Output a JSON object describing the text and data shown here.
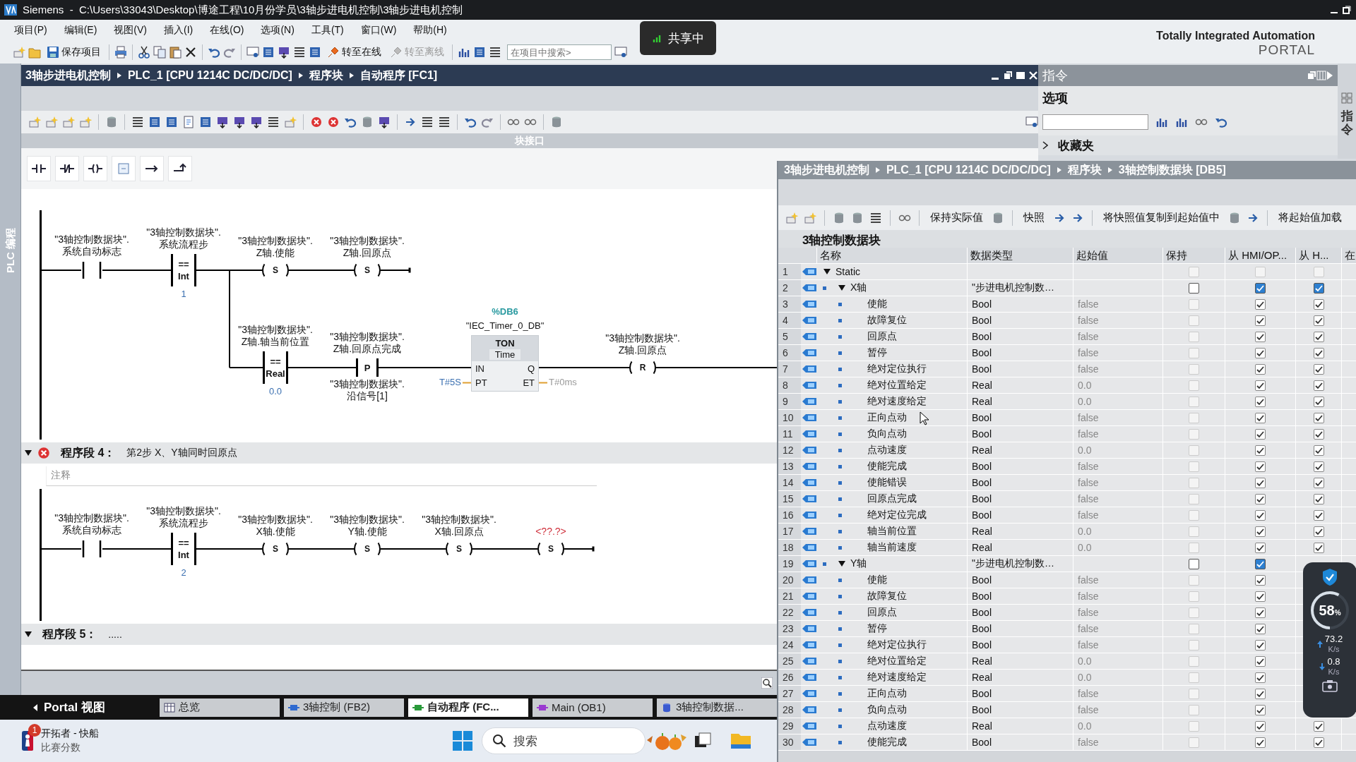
{
  "window": {
    "title": "Siemens  -  C:\\Users\\33043\\Desktop\\博途工程\\10月份学员\\3轴步进电机控制\\3轴步进电机控制"
  },
  "menu": [
    "项目(P)",
    "编辑(E)",
    "视图(V)",
    "插入(I)",
    "在线(O)",
    "选项(N)",
    "工具(T)",
    "窗口(W)",
    "帮助(H)"
  ],
  "toolbar": {
    "buttons": [
      {
        "label": "保存项目",
        "disabled": false
      },
      {
        "label": "转至在线",
        "disabled": false
      },
      {
        "label": "转至离线",
        "disabled": true
      }
    ],
    "search": {
      "placeholder": "在项目中搜索>"
    }
  },
  "brand": {
    "line1": "Totally Integrated Automation",
    "line2": "PORTAL"
  },
  "sharing_badge": {
    "label": "共享中"
  },
  "side_tab": {
    "label": "PLC 编程"
  },
  "editor": {
    "breadcrumb": [
      "3轴步进电机控制",
      "PLC_1 [CPU 1214C DC/DC/DC]",
      "程序块",
      "自动程序 [FC1]"
    ],
    "interface_bar": "块接口",
    "networks": [
      {
        "rows": [
          {
            "elements": [
              {
                "kind": "contact",
                "operand": "\"3轴控制数据块\".\n系统自动标志"
              },
              {
                "kind": "compare",
                "operand": "\"3轴控制数据块\".\n系统流程步",
                "op": "==",
                "type": "Int",
                "value": "1"
              },
              {
                "kind": "branch",
                "rows": [
                  {
                    "continues": false,
                    "elements": [
                      {
                        "kind": "coil",
                        "operand": "\"3轴控制数据块\".\nZ轴.使能",
                        "letter": "S",
                        "missing": false
                      },
                      {
                        "kind": "coil",
                        "operand": "\"3轴控制数据块\".\nZ轴.回原点",
                        "letter": "S",
                        "missing": false
                      }
                    ]
                  },
                  {
                    "continues": true,
                    "elements": [
                      {
                        "kind": "compare",
                        "operand": "\"3轴控制数据块\".\nZ轴.轴当前位置",
                        "op": "==",
                        "type": "Real",
                        "value": "0.0"
                      },
                      {
                        "kind": "edge",
                        "operand": "\"3轴控制数据块\".\nZ轴.回原点完成",
                        "letter": "P",
                        "operand_below": "\"3轴控制数据块\".\n沿信号[1]"
                      },
                      {
                        "kind": "timer",
                        "instance": "%DB6",
                        "instance_name": "\"IEC_Timer_0_DB\"",
                        "type": "TON",
                        "time_type": "Time",
                        "pins": [
                          {
                            "left": "IN",
                            "right": "Q"
                          },
                          {
                            "left": "PT",
                            "right": "ET",
                            "left_value": "T#5S",
                            "right_value": "T#0ms"
                          }
                        ]
                      },
                      {
                        "kind": "coil",
                        "operand": "\"3轴控制数据块\".\nZ轴.回原点",
                        "letter": "R",
                        "missing": false
                      }
                    ]
                  }
                ]
              }
            ]
          }
        ]
      },
      {
        "header": {
          "expanded": true,
          "error": true,
          "title": "程序段 4：",
          "comment": "第2步 X、Y轴同时回原点"
        },
        "comment_placeholder": "注释",
        "rows": [
          {
            "elements": [
              {
                "kind": "contact",
                "operand": "\"3轴控制数据块\".\n系统自动标志"
              },
              {
                "kind": "compare",
                "operand": "\"3轴控制数据块\".\n系统流程步",
                "op": "==",
                "type": "Int",
                "value": "2"
              },
              {
                "kind": "coil",
                "operand": "\"3轴控制数据块\".\nX轴.使能",
                "letter": "S",
                "missing": false
              },
              {
                "kind": "coil",
                "operand": "\"3轴控制数据块\".\nY轴.使能",
                "letter": "S",
                "missing": false
              },
              {
                "kind": "coil",
                "operand": "\"3轴控制数据块\".\nX轴.回原点",
                "letter": "S",
                "missing": false
              },
              {
                "kind": "coil",
                "operand": "<??.?>",
                "letter": "S",
                "missing": true
              }
            ]
          }
        ]
      },
      {
        "header": {
          "expanded": true,
          "error": false,
          "title": "程序段 5：",
          "comment": "....."
        }
      }
    ]
  },
  "instructions": {
    "title": "指令",
    "section": "选项",
    "favorites": "收藏夹",
    "side_tab": "指令"
  },
  "portal_bar": {
    "label": "Portal 视图",
    "tabs": [
      {
        "label": "总览",
        "kind": "overview",
        "selected": false
      },
      {
        "label": "3轴控制 (FB2)",
        "kind": "fb",
        "selected": false
      },
      {
        "label": "自动程序 (FC...",
        "kind": "fc",
        "selected": true
      },
      {
        "label": "Main (OB1)",
        "kind": "ob",
        "selected": false
      },
      {
        "label": "3轴控制数据...",
        "kind": "db",
        "selected": false
      }
    ]
  },
  "taskbar": {
    "notification": {
      "badge": "1",
      "title": "开拓者 - 快船",
      "subtitle": "比赛分数"
    },
    "search": {
      "placeholder": "搜索"
    }
  },
  "db_editor": {
    "breadcrumb": [
      "3轴步进电机控制",
      "PLC_1 [CPU 1214C DC/DC/DC]",
      "程序块",
      "3轴控制数据块 [DB5]"
    ],
    "toolbar": [
      "保持实际值",
      "快照",
      "将快照值复制到起始值中",
      "将起始值加载"
    ],
    "title": "3轴控制数据块",
    "columns": [
      "名称",
      "数据类型",
      "起始值",
      "保持",
      "从 HMI/OP...",
      "从 H...",
      "在"
    ],
    "variables": [
      {
        "no": "1",
        "name": "Static",
        "expanded": true,
        "retain": false,
        "hmi_accessible": false,
        "hmi_writable": false,
        "children": [
          {
            "no": "2",
            "name": "X轴",
            "type": "\"步进电机控制数…",
            "expanded": true,
            "retain": false,
            "hmi_accessible": true,
            "hmi_writable": true,
            "children": [
              {
                "no": "3",
                "name": "使能",
                "type": "Bool",
                "start": "false",
                "retain": false,
                "hmi_accessible": true,
                "hmi_writable": true
              },
              {
                "no": "4",
                "name": "故障复位",
                "type": "Bool",
                "start": "false",
                "retain": false,
                "hmi_accessible": true,
                "hmi_writable": true
              },
              {
                "no": "5",
                "name": "回原点",
                "type": "Bool",
                "start": "false",
                "retain": false,
                "hmi_accessible": true,
                "hmi_writable": true
              },
              {
                "no": "6",
                "name": "暂停",
                "type": "Bool",
                "start": "false",
                "retain": false,
                "hmi_accessible": true,
                "hmi_writable": true
              },
              {
                "no": "7",
                "name": "绝对定位执行",
                "type": "Bool",
                "start": "false",
                "retain": false,
                "hmi_accessible": true,
                "hmi_writable": true
              },
              {
                "no": "8",
                "name": "绝对位置给定",
                "type": "Real",
                "start": "0.0",
                "retain": false,
                "hmi_accessible": true,
                "hmi_writable": true
              },
              {
                "no": "9",
                "name": "绝对速度给定",
                "type": "Real",
                "start": "0.0",
                "retain": false,
                "hmi_accessible": true,
                "hmi_writable": true
              },
              {
                "no": "10",
                "name": "正向点动",
                "type": "Bool",
                "start": "false",
                "retain": false,
                "hmi_accessible": true,
                "hmi_writable": true
              },
              {
                "no": "11",
                "name": "负向点动",
                "type": "Bool",
                "start": "false",
                "retain": false,
                "hmi_accessible": true,
                "hmi_writable": true
              },
              {
                "no": "12",
                "name": "点动速度",
                "type": "Real",
                "start": "0.0",
                "retain": false,
                "hmi_accessible": true,
                "hmi_writable": true
              },
              {
                "no": "13",
                "name": "使能完成",
                "type": "Bool",
                "start": "false",
                "retain": false,
                "hmi_accessible": true,
                "hmi_writable": true
              },
              {
                "no": "14",
                "name": "使能错误",
                "type": "Bool",
                "start": "false",
                "retain": false,
                "hmi_accessible": true,
                "hmi_writable": true
              },
              {
                "no": "15",
                "name": "回原点完成",
                "type": "Bool",
                "start": "false",
                "retain": false,
                "hmi_accessible": true,
                "hmi_writable": true
              },
              {
                "no": "16",
                "name": "绝对定位完成",
                "type": "Bool",
                "start": "false",
                "retain": false,
                "hmi_accessible": true,
                "hmi_writable": true
              },
              {
                "no": "17",
                "name": "轴当前位置",
                "type": "Real",
                "start": "0.0",
                "retain": false,
                "hmi_accessible": true,
                "hmi_writable": true
              },
              {
                "no": "18",
                "name": "轴当前速度",
                "type": "Real",
                "start": "0.0",
                "retain": false,
                "hmi_accessible": true,
                "hmi_writable": true
              }
            ]
          },
          {
            "no": "19",
            "name": "Y轴",
            "type": "\"步进电机控制数…",
            "expanded": true,
            "retain": false,
            "hmi_accessible": true,
            "children": [
              {
                "no": "20",
                "name": "使能",
                "type": "Bool",
                "start": "false",
                "retain": false,
                "hmi_accessible": true
              },
              {
                "no": "21",
                "name": "故障复位",
                "type": "Bool",
                "start": "false",
                "retain": false,
                "hmi_accessible": true
              },
              {
                "no": "22",
                "name": "回原点",
                "type": "Bool",
                "start": "false",
                "retain": false,
                "hmi_accessible": true
              },
              {
                "no": "23",
                "name": "暂停",
                "type": "Bool",
                "start": "false",
                "retain": false,
                "hmi_accessible": true
              },
              {
                "no": "24",
                "name": "绝对定位执行",
                "type": "Bool",
                "start": "false",
                "retain": false,
                "hmi_accessible": true
              },
              {
                "no": "25",
                "name": "绝对位置给定",
                "type": "Real",
                "start": "0.0",
                "retain": false,
                "hmi_accessible": true
              },
              {
                "no": "26",
                "name": "绝对速度给定",
                "type": "Real",
                "start": "0.0",
                "retain": false,
                "hmi_accessible": true
              },
              {
                "no": "27",
                "name": "正向点动",
                "type": "Bool",
                "start": "false",
                "retain": false,
                "hmi_accessible": true
              },
              {
                "no": "28",
                "name": "负向点动",
                "type": "Bool",
                "start": "false",
                "retain": false,
                "hmi_accessible": true
              },
              {
                "no": "29",
                "name": "点动速度",
                "type": "Real",
                "start": "0.0",
                "retain": false,
                "hmi_accessible": true,
                "hmi_writable": true
              },
              {
                "no": "30",
                "name": "使能完成",
                "type": "Bool",
                "start": "false",
                "retain": false,
                "hmi_accessible": true,
                "hmi_writable": true
              }
            ]
          }
        ]
      }
    ]
  },
  "monitor": {
    "level": 0.58,
    "value": "58",
    "unit": "%",
    "upload": "73.2",
    "upload_unit": "K/s",
    "download": "0.8",
    "download_unit": "K/s"
  }
}
